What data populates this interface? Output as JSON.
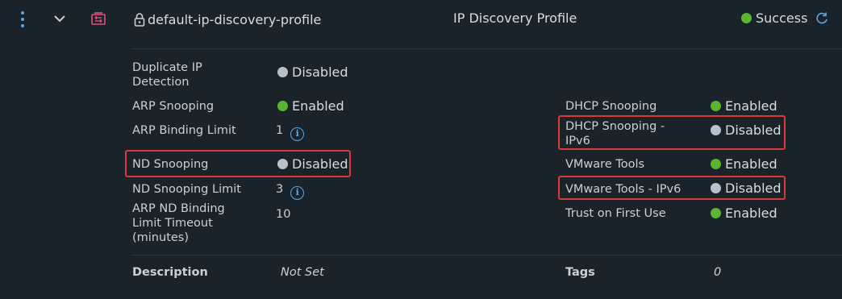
{
  "row": {
    "name": "default-ip-discovery-profile",
    "type": "IP Discovery Profile",
    "status": "Success",
    "status_color": "#5ab532",
    "expand_icon": "chevron-down-icon",
    "menu_icon": "vertical-ellipsis-icon",
    "profile_icon": "ip-discovery-profile-icon",
    "lock_icon": "lock-icon",
    "refresh_icon": "refresh-icon"
  },
  "left": [
    {
      "label": "Duplicate IP Detection",
      "value": "Disabled",
      "state": "gray"
    },
    {
      "label": "ARP Snooping",
      "value": "Enabled",
      "state": "green"
    },
    {
      "label": "ARP Binding Limit",
      "value": "1"
    },
    {
      "label": "ND Snooping",
      "value": "Disabled",
      "state": "gray",
      "highlighted": true
    },
    {
      "label": "ND Snooping Limit",
      "value": "3"
    },
    {
      "label": "ARP ND Binding Limit Timeout (minutes)",
      "value": "10"
    }
  ],
  "right": [
    {
      "label": "DHCP Snooping",
      "value": "Enabled",
      "state": "green"
    },
    {
      "label": "DHCP Snooping - IPv6",
      "value": "Disabled",
      "state": "gray",
      "highlighted": true
    },
    {
      "label": "VMware Tools",
      "value": "Enabled",
      "state": "green"
    },
    {
      "label": "VMware Tools - IPv6",
      "value": "Disabled",
      "state": "gray",
      "highlighted": true
    },
    {
      "label": "Trust on First Use",
      "value": "Enabled",
      "state": "green"
    }
  ],
  "footer": {
    "description_label": "Description",
    "description_value": "Not Set",
    "tags_label": "Tags",
    "tags_value": "0"
  },
  "colors": {
    "enabled": "#5ab532",
    "disabled": "#b8c1c8",
    "highlight": "#d93a3a",
    "info": "#5aa8e6",
    "background": "#1b232a"
  }
}
